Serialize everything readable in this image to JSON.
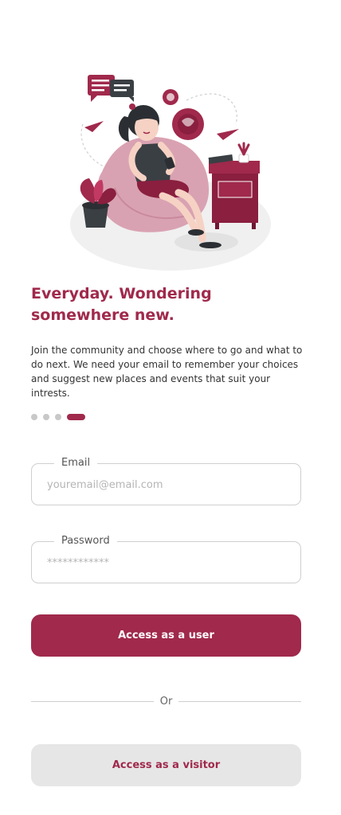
{
  "onboarding": {
    "headline": "Everyday. Wondering somewhere new.",
    "description": "Join the community and choose where to go and what to do next. We need your email to remember your choices and suggest new places and events that suit your intrests.",
    "pager": {
      "total_pages": 4,
      "current_page": 4
    }
  },
  "form": {
    "email": {
      "label": "Email",
      "placeholder": "youremail@email.com",
      "value": ""
    },
    "password": {
      "label": "Password",
      "placeholder": "************",
      "value": ""
    }
  },
  "actions": {
    "user_button_label": "Access as a user",
    "divider_label": "Or",
    "visitor_button_label": "Access as a visitor"
  },
  "colors": {
    "brand": "#a0294c",
    "secondary_button_bg": "#e6e6e6",
    "border": "#cfcfcf"
  }
}
